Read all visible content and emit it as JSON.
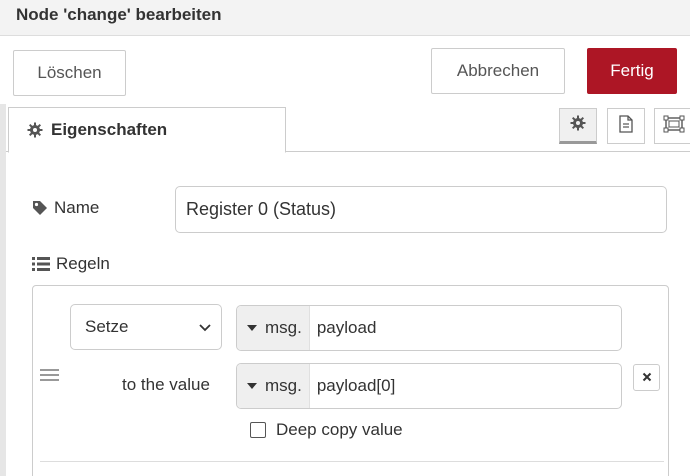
{
  "header": {
    "title": "Node 'change' bearbeiten"
  },
  "toolbar": {
    "delete_label": "Löschen",
    "cancel_label": "Abbrechen",
    "done_label": "Fertig"
  },
  "tabs": [
    {
      "label": "Eigenschaften",
      "icon": "gear-icon"
    }
  ],
  "tab_icons": [
    "gear-icon",
    "document-icon",
    "frame-icon"
  ],
  "form": {
    "name_label": "Name",
    "name_value": "Register 0 (Status)",
    "rules_label": "Regeln"
  },
  "rules": [
    {
      "action": "Setze",
      "target_type": "msg.",
      "target_value": "payload",
      "to_label": "to the value",
      "value_type": "msg.",
      "value": "payload[0]",
      "deep_copy_label": "Deep copy value",
      "deep_copy_checked": false
    }
  ],
  "colors": {
    "primary": "#ad1625",
    "header_bg": "#f3f3f3",
    "border": "#cccccc"
  }
}
